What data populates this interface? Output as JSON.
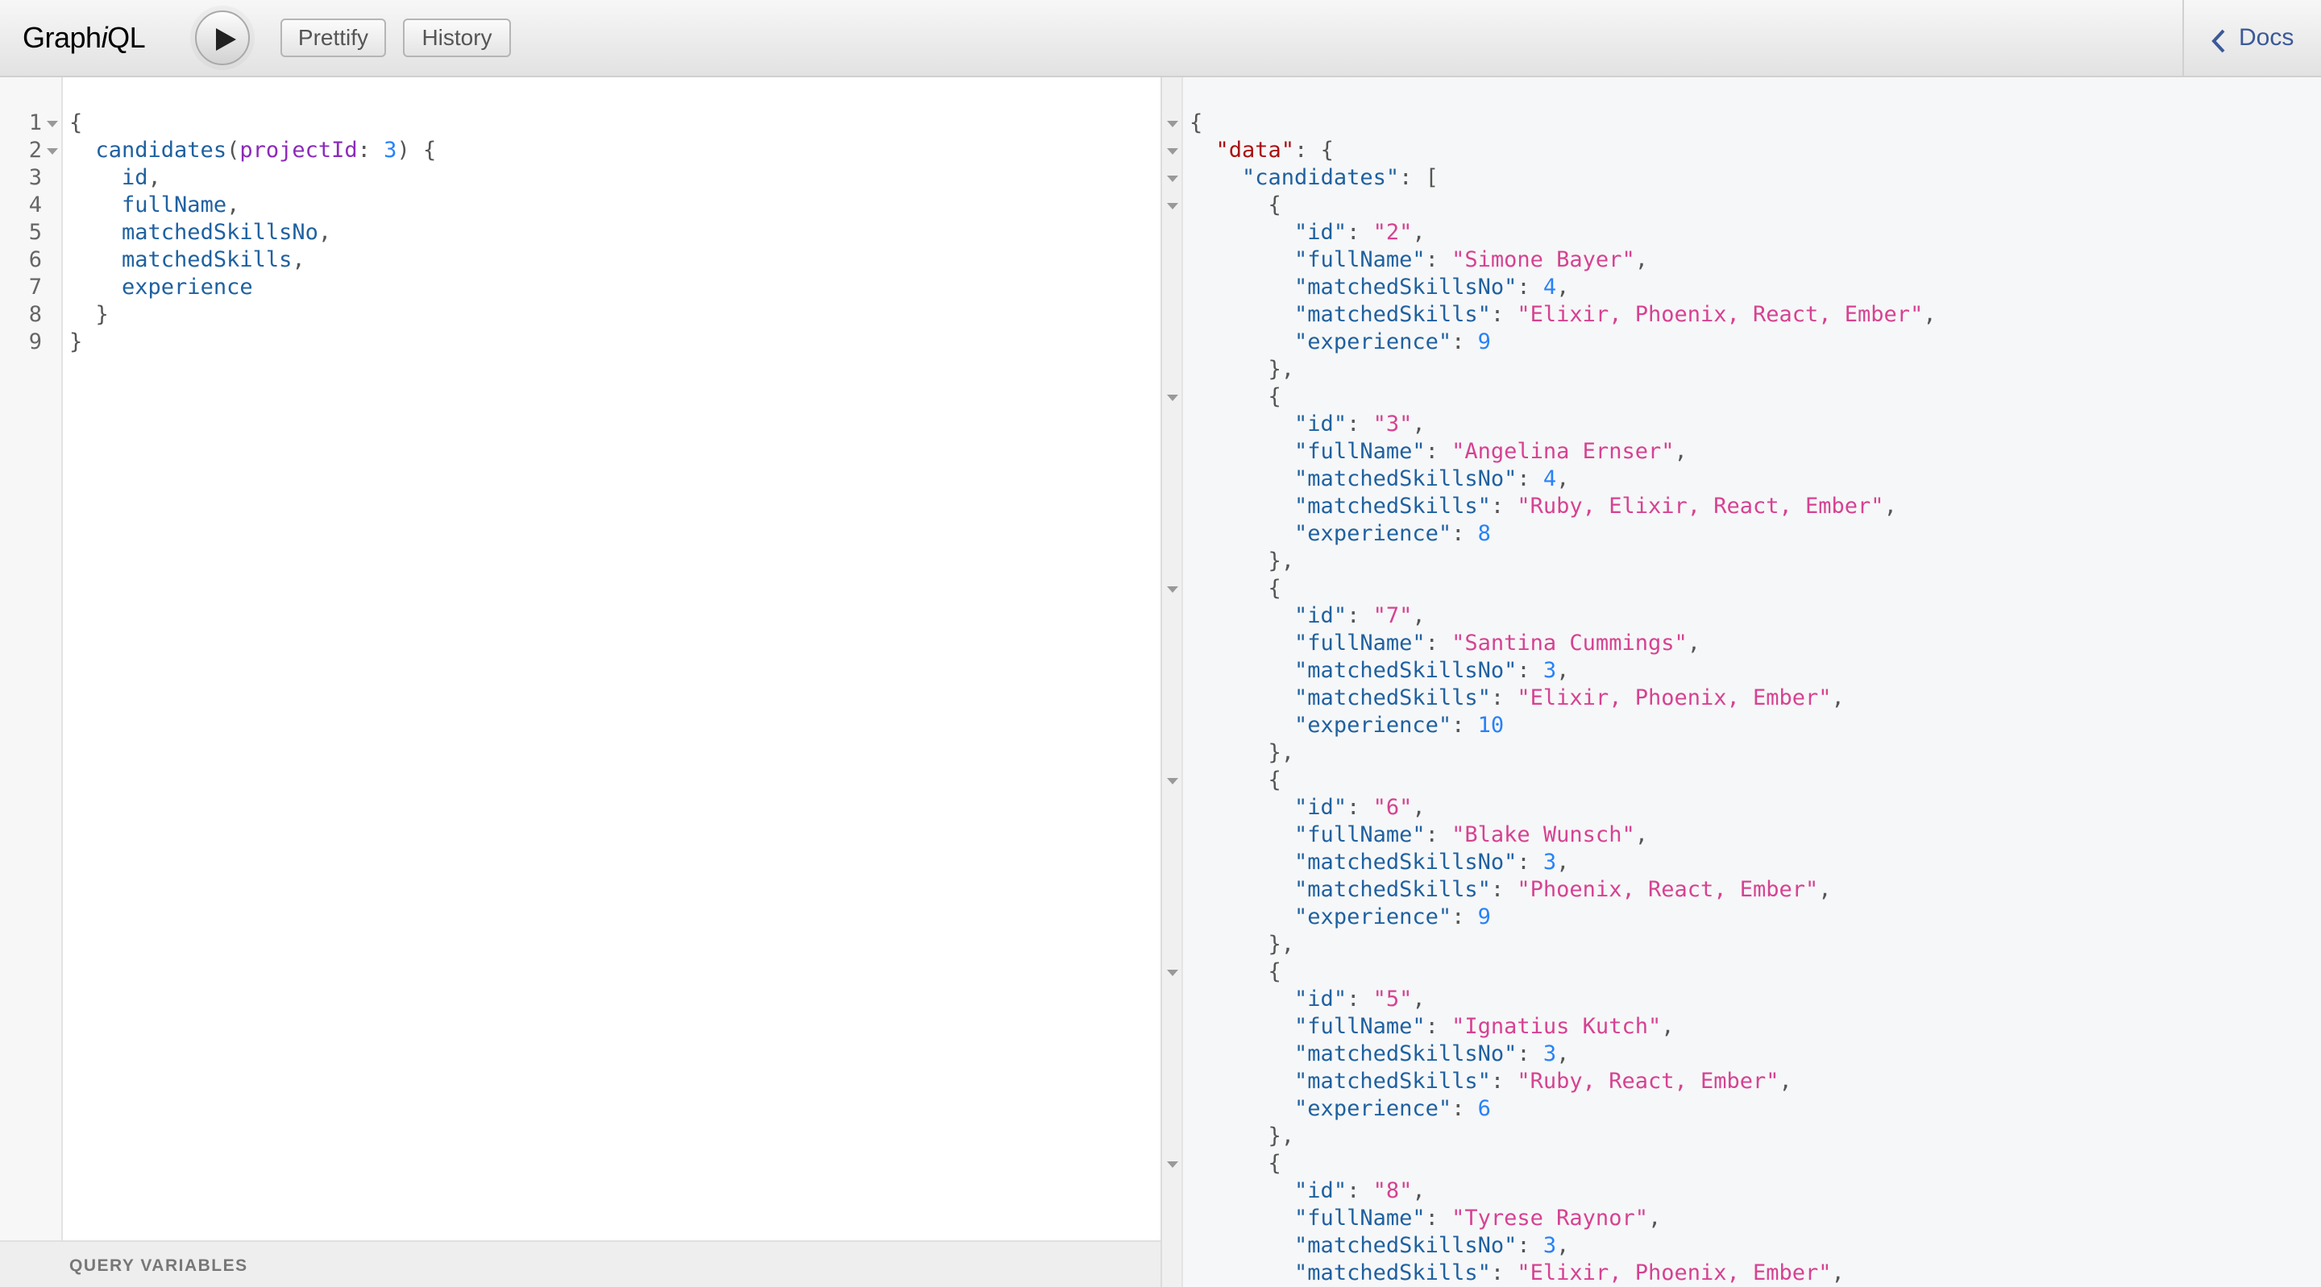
{
  "header": {
    "title_prefix": "Graph",
    "title_italic": "i",
    "title_suffix": "QL",
    "execute_label": "Execute Query",
    "prettify_label": "Prettify",
    "history_label": "History",
    "docs_label": "Docs"
  },
  "query": {
    "line_numbers": [
      "1",
      "2",
      "3",
      "4",
      "5",
      "6",
      "7",
      "8",
      "9"
    ],
    "open_brace": "{",
    "field": "candidates",
    "arg_name": "projectId",
    "arg_value": "3",
    "selections": [
      "id",
      "fullName",
      "matchedSkillsNo",
      "matchedSkills",
      "experience"
    ],
    "close_brace": "}"
  },
  "variables_title": "QUERY VARIABLES",
  "result": {
    "root_key": "data",
    "list_key": "candidates",
    "candidates": [
      {
        "id": "2",
        "fullName": "Simone Bayer",
        "matchedSkillsNo": 4,
        "matchedSkills": "Elixir, Phoenix, React, Ember",
        "experience": 9
      },
      {
        "id": "3",
        "fullName": "Angelina Ernser",
        "matchedSkillsNo": 4,
        "matchedSkills": "Ruby, Elixir, React, Ember",
        "experience": 8
      },
      {
        "id": "7",
        "fullName": "Santina Cummings",
        "matchedSkillsNo": 3,
        "matchedSkills": "Elixir, Phoenix, Ember",
        "experience": 10
      },
      {
        "id": "6",
        "fullName": "Blake Wunsch",
        "matchedSkillsNo": 3,
        "matchedSkills": "Phoenix, React, Ember",
        "experience": 9
      },
      {
        "id": "5",
        "fullName": "Ignatius Kutch",
        "matchedSkillsNo": 3,
        "matchedSkills": "Ruby, React, Ember",
        "experience": 6
      },
      {
        "id": "8",
        "fullName": "Tyrese Raynor",
        "matchedSkillsNo": 3,
        "matchedSkills": "Elixir, Phoenix, Ember"
      }
    ]
  }
}
